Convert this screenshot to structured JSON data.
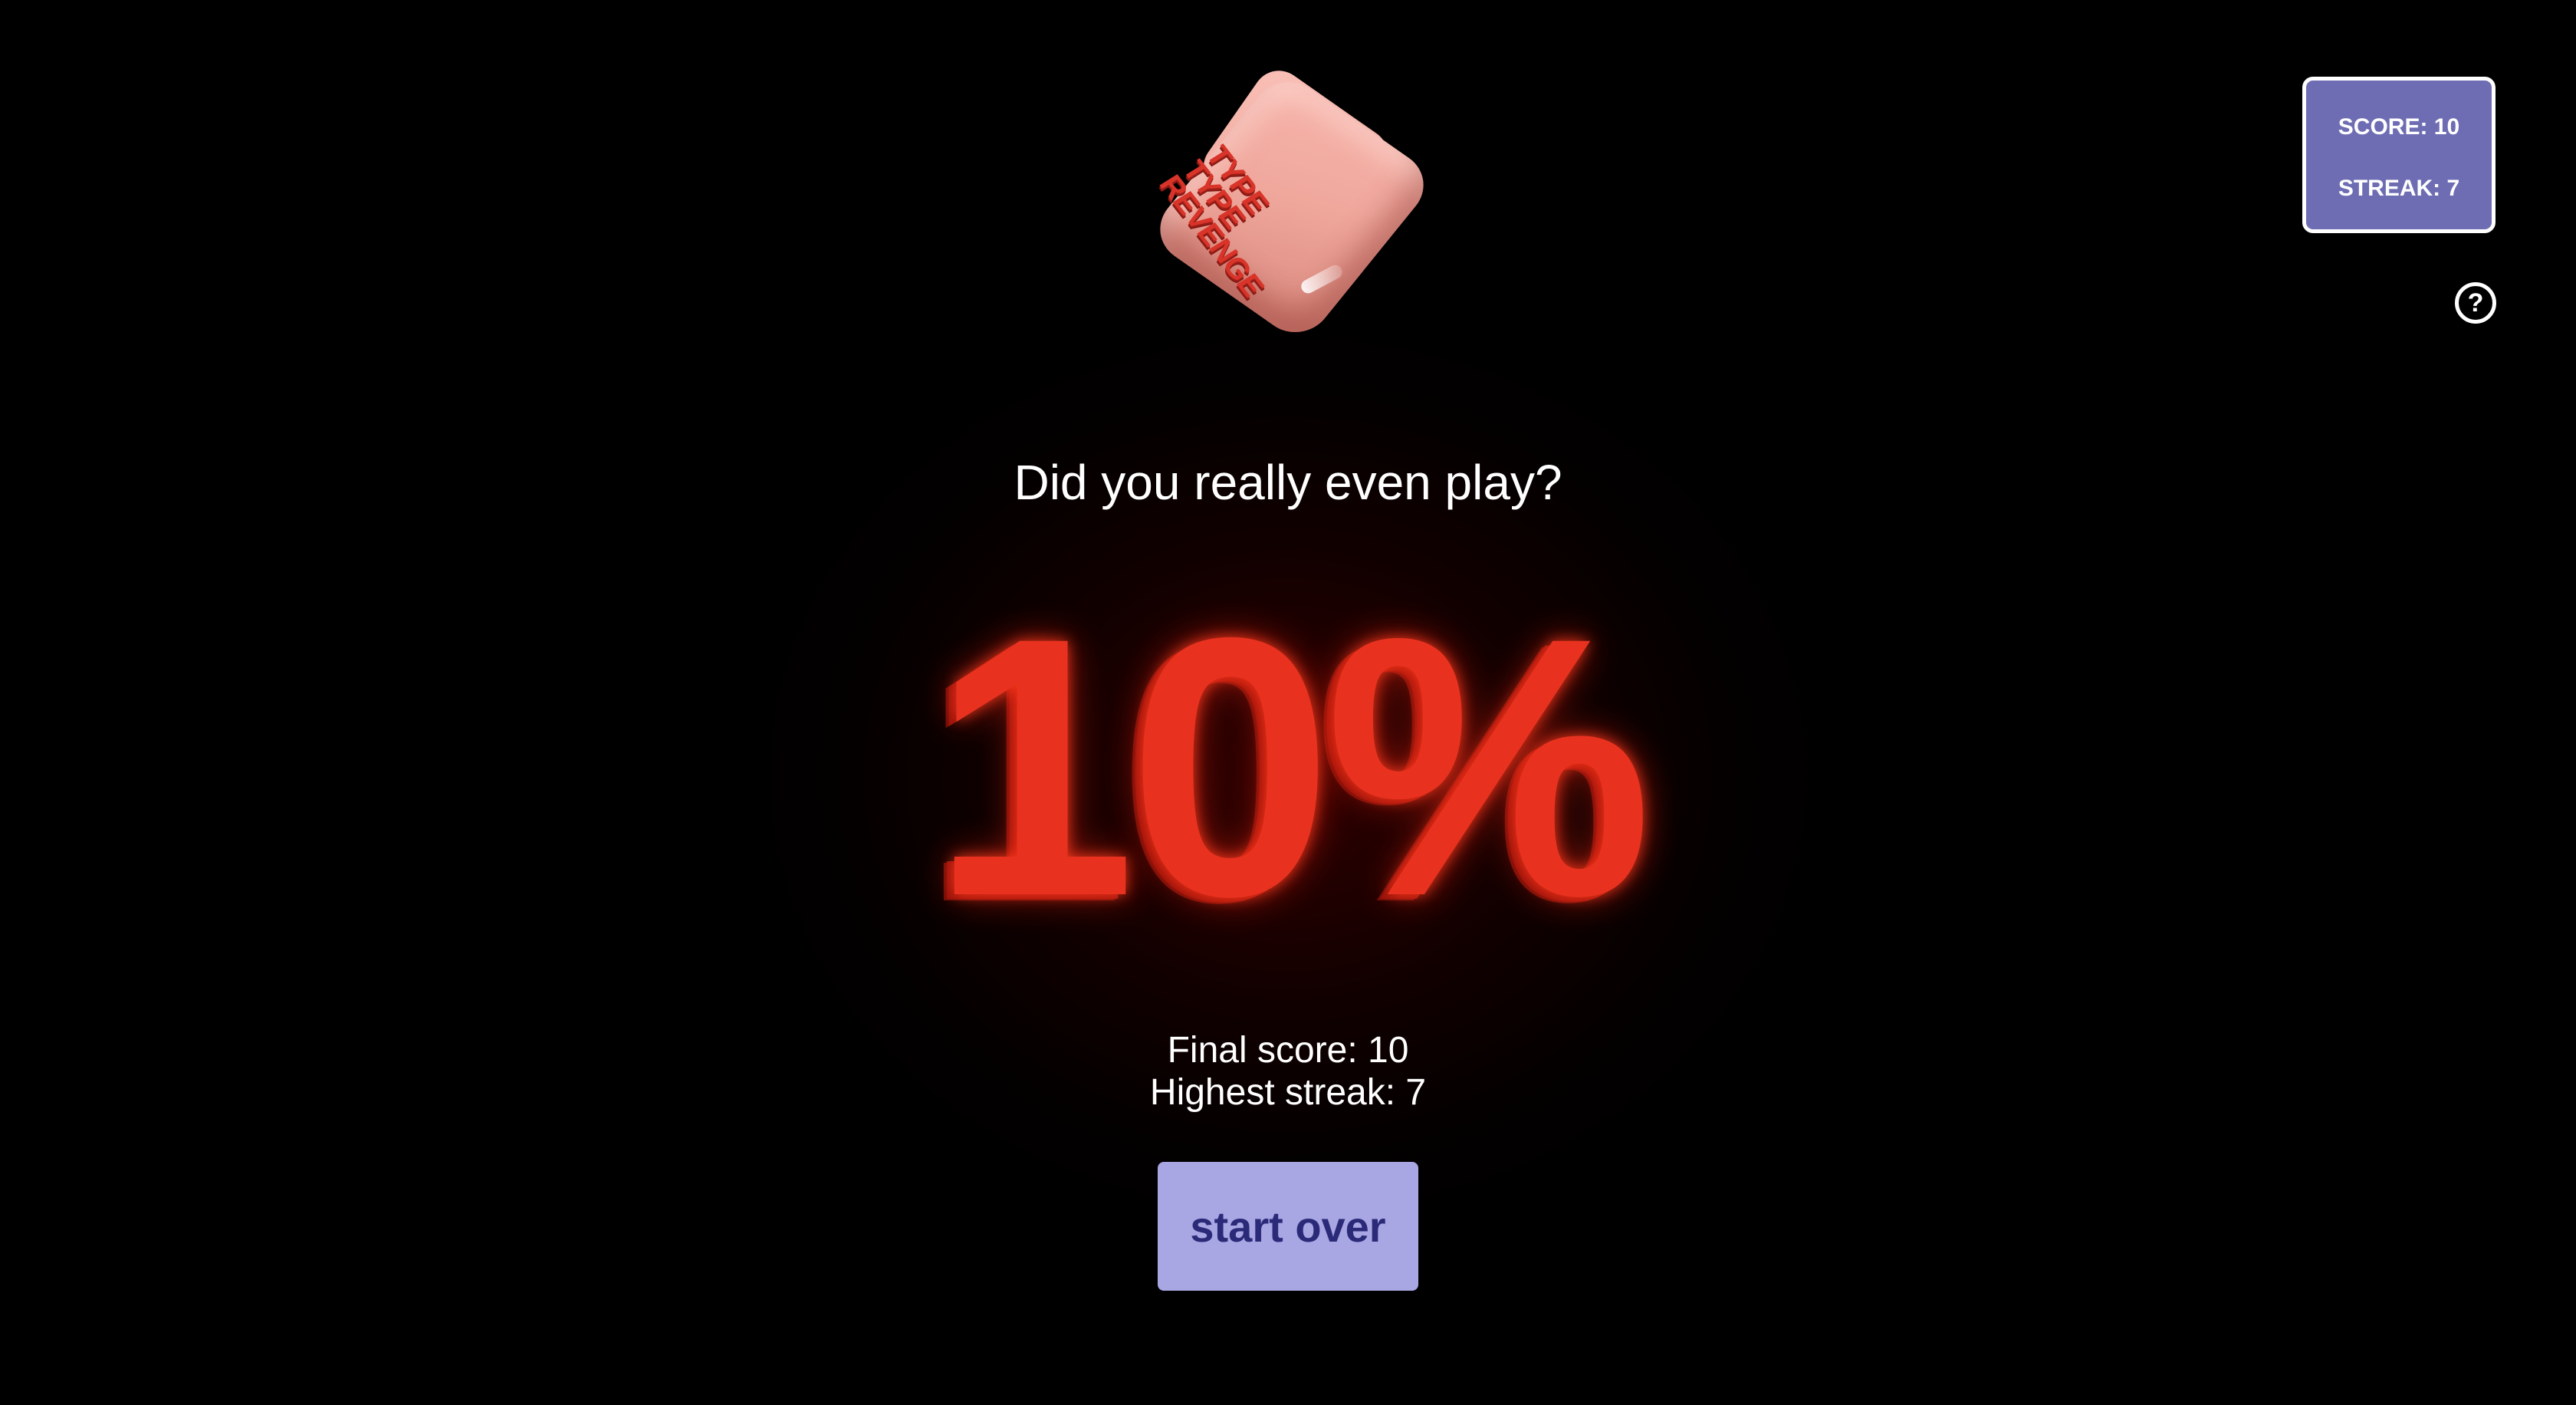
{
  "logo": {
    "lines": [
      "TYPE",
      "TYPE",
      "REVENGE"
    ]
  },
  "score_panel": {
    "score_text": "SCORE: 10",
    "streak_text": "STREAK: 7"
  },
  "help": {
    "glyph": "?"
  },
  "result": {
    "headline": "Did you really even play?",
    "percentage": "10%",
    "final_score": "Final score: 10",
    "highest_streak": "Highest streak: 7"
  },
  "actions": {
    "start_over_label": "start over"
  },
  "colors": {
    "background": "#000000",
    "percent_red": "#e8321f",
    "panel_purple": "#6e6db4",
    "button_lavender": "#a8a6e3",
    "button_text": "#2a2a78",
    "cube_pink": "#f0a89d"
  }
}
